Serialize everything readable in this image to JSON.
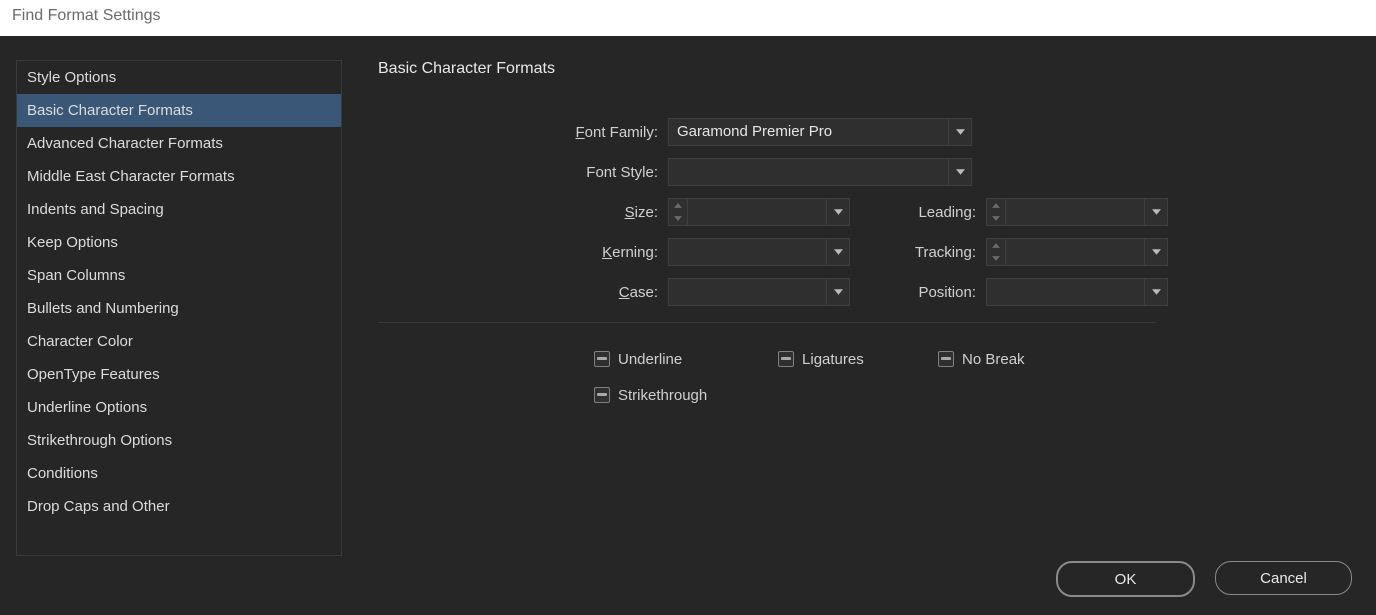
{
  "window": {
    "title": "Find Format Settings"
  },
  "sidebar": {
    "items": [
      "Style Options",
      "Basic Character Formats",
      "Advanced Character Formats",
      "Middle East Character Formats",
      "Indents and Spacing",
      "Keep Options",
      "Span Columns",
      "Bullets and Numbering",
      "Character Color",
      "OpenType Features",
      "Underline Options",
      "Strikethrough Options",
      "Conditions",
      "Drop Caps and Other"
    ],
    "selected_index": 1
  },
  "panel": {
    "title": "Basic Character Formats",
    "labels": {
      "font_family": "Font Family:",
      "font_style": "Font Style:",
      "size": "Size:",
      "leading": "Leading:",
      "kerning": "Kerning:",
      "tracking": "Tracking:",
      "case": "Case:",
      "position": "Position:"
    },
    "values": {
      "font_family": "Garamond Premier Pro",
      "font_style": "",
      "size": "",
      "leading": "",
      "kerning": "",
      "tracking": "",
      "case": "",
      "position": ""
    },
    "checkboxes": {
      "underline": "Underline",
      "ligatures": "Ligatures",
      "no_break": "No Break",
      "strikethrough": "Strikethrough"
    }
  },
  "buttons": {
    "ok": "OK",
    "cancel": "Cancel"
  }
}
